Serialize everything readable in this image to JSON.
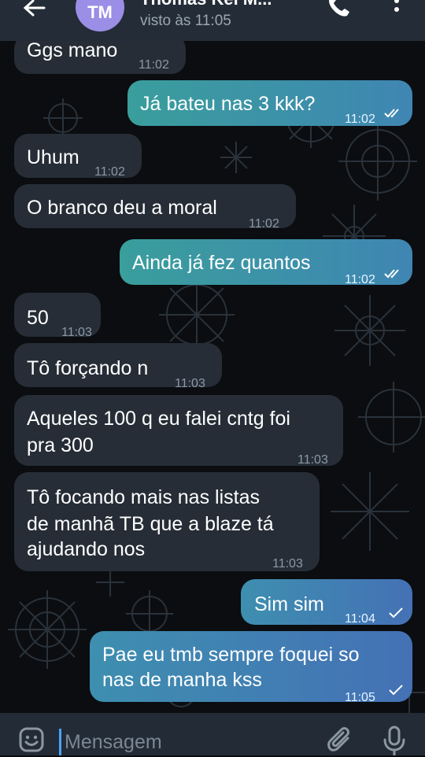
{
  "header": {
    "avatar_initials": "TM",
    "contact_name": "Thomas Kel M...",
    "last_seen": "visto às 11:05"
  },
  "messages": [
    {
      "direction": "in",
      "lines": [
        "Ggs mano"
      ],
      "time": "11:02"
    },
    {
      "direction": "out",
      "lines": [
        "Já bateu nas 3 kkk?"
      ],
      "time": "11:02",
      "status": "read"
    },
    {
      "direction": "in",
      "lines": [
        "Uhum"
      ],
      "time": "11:02"
    },
    {
      "direction": "in",
      "lines": [
        "O branco deu a moral"
      ],
      "time": "11:02"
    },
    {
      "direction": "out",
      "lines": [
        "Ainda já fez quantos"
      ],
      "time": "11:02",
      "status": "read"
    },
    {
      "direction": "in",
      "lines": [
        "50"
      ],
      "time": "11:03"
    },
    {
      "direction": "in",
      "lines": [
        "Tô forçando n"
      ],
      "time": "11:03"
    },
    {
      "direction": "in",
      "lines": [
        "Aqueles 100 q eu falei cntg foi",
        "pra 300"
      ],
      "time": "11:03"
    },
    {
      "direction": "in",
      "lines": [
        "Tô focando mais nas listas",
        "de manhã TB que a blaze tá",
        "ajudando nos"
      ],
      "time": "11:03"
    },
    {
      "direction": "out",
      "lines": [
        "Sim sim"
      ],
      "time": "11:04",
      "status": "sent"
    },
    {
      "direction": "out",
      "lines": [
        "Pae eu tmb sempre foquei so",
        "nas de manha kss"
      ],
      "time": "11:05",
      "status": "sent"
    }
  ],
  "input": {
    "placeholder": "Mensagem"
  },
  "colors": {
    "header_bg": "#242d37",
    "incoming_bubble": "#262d36",
    "outgoing_gradient_start": "#3a9e9c",
    "outgoing_gradient_end": "#4471b5",
    "avatar_bg": "#9b8ee6",
    "cursor": "#4aa3ff"
  },
  "icons": [
    "back-arrow-icon",
    "phone-icon",
    "more-vertical-icon",
    "emoji-icon",
    "attach-icon",
    "microphone-icon",
    "double-check-icon",
    "check-icon"
  ]
}
